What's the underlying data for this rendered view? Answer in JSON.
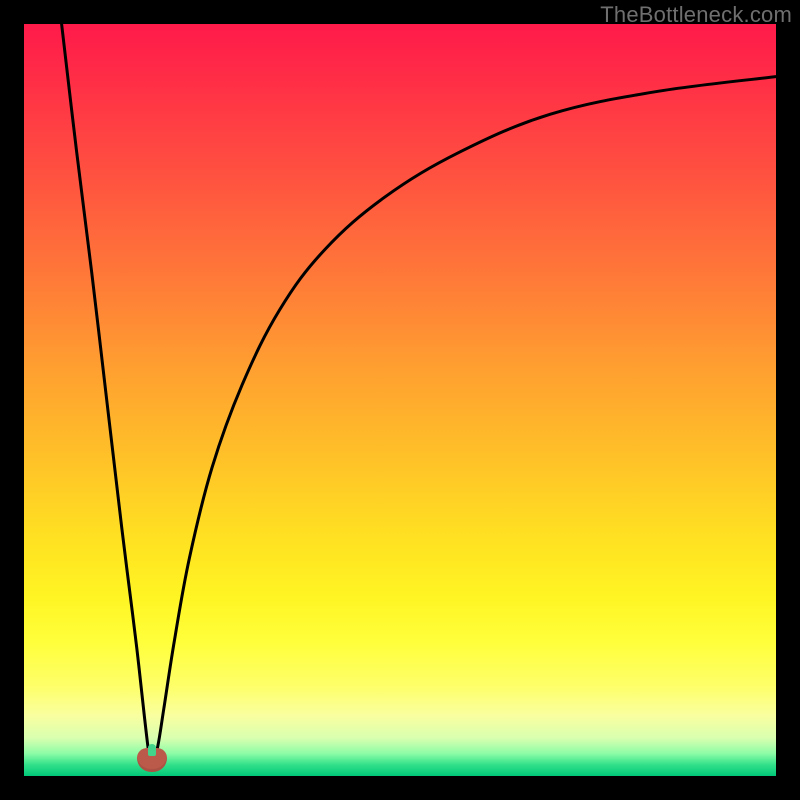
{
  "watermark": "TheBottleneck.com",
  "colors": {
    "frame": "#000000",
    "curve": "#000000",
    "marker": "#bb5a4a"
  },
  "chart_data": {
    "type": "line",
    "title": "",
    "xlabel": "",
    "ylabel": "",
    "xlim": [
      0,
      100
    ],
    "ylim": [
      0,
      100
    ],
    "grid": false,
    "legend": false,
    "annotations": [
      {
        "name": "minimum-marker",
        "x": 17,
        "y": 1
      }
    ],
    "series": [
      {
        "name": "left-branch",
        "x": [
          5,
          7,
          9,
          11,
          13,
          14,
          15,
          16,
          16.6,
          17
        ],
        "y": [
          100,
          83,
          67,
          50,
          33,
          25,
          17,
          8,
          3,
          1
        ]
      },
      {
        "name": "right-branch",
        "x": [
          17,
          17.8,
          18.6,
          20,
          22,
          25,
          29,
          34,
          40,
          48,
          58,
          70,
          84,
          100
        ],
        "y": [
          1,
          4,
          9,
          18,
          29,
          41,
          52,
          62,
          70,
          77,
          83,
          88,
          91,
          93
        ]
      }
    ]
  }
}
